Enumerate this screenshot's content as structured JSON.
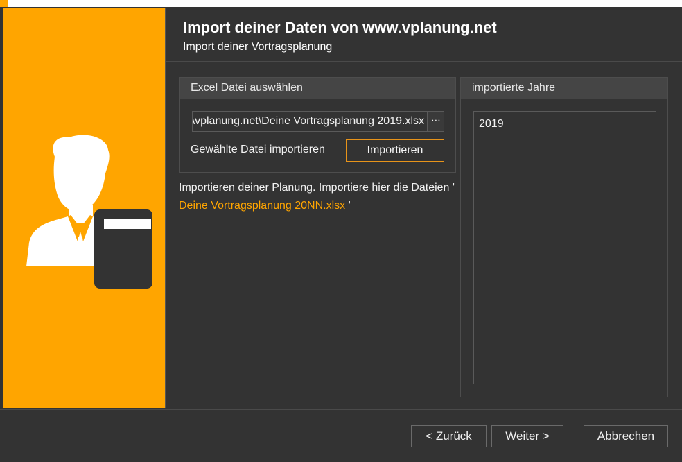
{
  "header": {
    "title": "Import deiner Daten von www.vplanung.net",
    "subtitle": "Import deiner Vortragsplanung"
  },
  "excel_group": {
    "title": "Excel Datei auswählen",
    "file_path": "\\vplanung.net\\Deine Vortragsplanung 2019.xlsx",
    "browse_label": "⋯",
    "import_label": "Gewählte Datei importieren",
    "import_button": "Importieren"
  },
  "info": {
    "text": "Importieren deiner Planung. Importiere hier die Dateien '",
    "file_name": "Deine Vortragsplanung 20NN.xlsx",
    "suffix": "'"
  },
  "years_group": {
    "title": "importierte Jahre",
    "items": [
      "2019"
    ]
  },
  "footer": {
    "back": "< Zurück",
    "next": "Weiter >",
    "cancel": "Abbrechen"
  },
  "colors": {
    "accent": "#ffa500",
    "background": "#333333",
    "group_header": "#454545",
    "import_border": "#e8941a"
  },
  "icons": {
    "banner": "user-with-book-icon"
  }
}
